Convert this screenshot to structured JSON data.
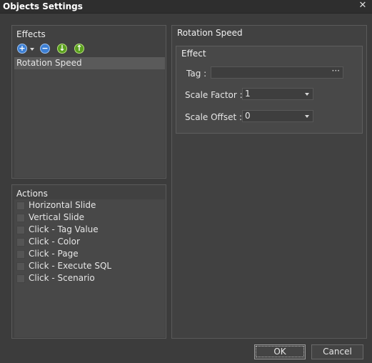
{
  "window": {
    "title": "Objects Settings",
    "close_glyph": "✕"
  },
  "effects": {
    "header": "Effects",
    "toolbar": [
      {
        "icon": "add-dropdown-icon",
        "glyph": "+"
      },
      {
        "icon": "remove-icon",
        "glyph": "−"
      },
      {
        "icon": "move-down-icon",
        "glyph": "↓"
      },
      {
        "icon": "move-up-icon",
        "glyph": "↑"
      }
    ],
    "items": [
      "Rotation Speed"
    ],
    "selected": "Rotation Speed"
  },
  "actions": {
    "header": "Actions",
    "items": [
      {
        "label": "Horizontal Slide",
        "checked": false
      },
      {
        "label": "Vertical Slide",
        "checked": false
      },
      {
        "label": "Click - Tag Value",
        "checked": false
      },
      {
        "label": "Click - Color",
        "checked": false
      },
      {
        "label": "Click - Page",
        "checked": false
      },
      {
        "label": "Click - Execute SQL",
        "checked": false
      },
      {
        "label": "Click - Scenario",
        "checked": false
      }
    ]
  },
  "details": {
    "header": "Rotation Speed",
    "group_header": "Effect",
    "tag_label": "Tag :",
    "tag_value": "",
    "tag_button": "···",
    "scale_factor_label": "Scale Factor :",
    "scale_factor_value": "1",
    "scale_offset_label": "Scale Offset :",
    "scale_offset_value": "0"
  },
  "buttons": {
    "ok": "OK",
    "cancel": "Cancel"
  }
}
